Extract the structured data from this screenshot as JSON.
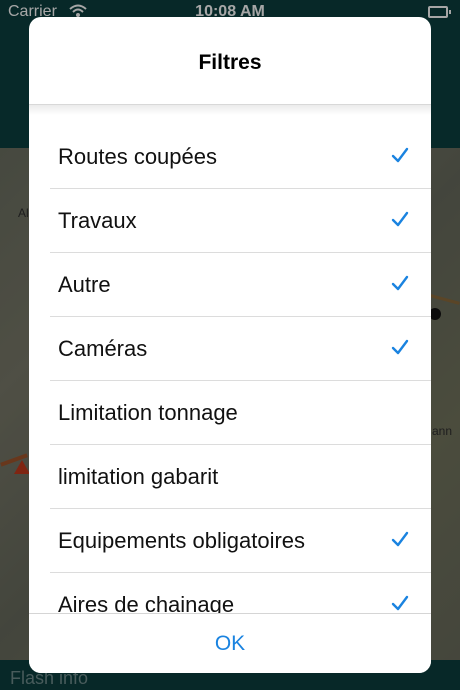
{
  "status_bar": {
    "carrier": "Carrier",
    "time": "10:08 AM"
  },
  "background": {
    "map_label_left": "Al",
    "map_label_right": "ann",
    "bottom_label": "Flash info"
  },
  "dialog": {
    "title": "Filtres",
    "ok_label": "OK",
    "accent_color": "#1a83e0",
    "items": [
      {
        "label": "Routes coupées",
        "checked": true
      },
      {
        "label": "Travaux",
        "checked": true
      },
      {
        "label": "Autre",
        "checked": true
      },
      {
        "label": "Caméras",
        "checked": true
      },
      {
        "label": "Limitation tonnage",
        "checked": false
      },
      {
        "label": "limitation gabarit",
        "checked": false
      },
      {
        "label": "Equipements obligatoires",
        "checked": true
      },
      {
        "label": "Aires de chainage",
        "checked": true
      }
    ]
  }
}
